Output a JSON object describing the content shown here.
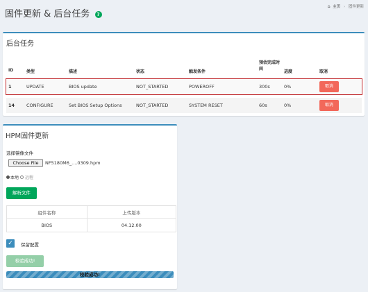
{
  "header": {
    "title": "固件更新 & 后台任务",
    "help_glyph": "?",
    "breadcrumb": {
      "home": "主页",
      "current": "固件更新"
    }
  },
  "tasks": {
    "title": "后台任务",
    "columns": {
      "id": "ID",
      "type": "类型",
      "desc": "描述",
      "status": "状态",
      "trigger": "触发条件",
      "eta": "预估完成时间",
      "progress": "进度",
      "cancel": "取消"
    },
    "rows": [
      {
        "id": "1",
        "type": "UPDATE",
        "desc": "BIOS update",
        "status": "NOT_STARTED",
        "trigger": "POWEROFF",
        "eta": "300s",
        "progress": "0%",
        "cancel": "取消"
      },
      {
        "id": "14",
        "type": "CONFIGURE",
        "desc": "Set BIOS Setup Options",
        "status": "NOT_STARTED",
        "trigger": "SYSTEM RESET",
        "eta": "60s",
        "progress": "0%",
        "cancel": "取消"
      }
    ]
  },
  "hpm": {
    "title": "HPM固件更新",
    "select_label": "选择镜像文件",
    "file_button": "Choose File",
    "file_name": "NF5180M6_....0309.hpm",
    "radio_local": "本地",
    "radio_remote": "远程",
    "parse_button": "解析文件",
    "table": {
      "headers": [
        "组件名称",
        "上传版本"
      ],
      "rows": [
        [
          "BIOS",
          "04.12.00"
        ]
      ]
    },
    "keep_config": "保留配置",
    "verify_button": "校验成功!",
    "progress": {
      "fraction": 1.0,
      "text": "校验成功!"
    }
  },
  "colors": {
    "accent": "#3c8dbc",
    "success": "#00a65a",
    "danger": "#f2685a",
    "highlight_border": "#c0262a"
  }
}
